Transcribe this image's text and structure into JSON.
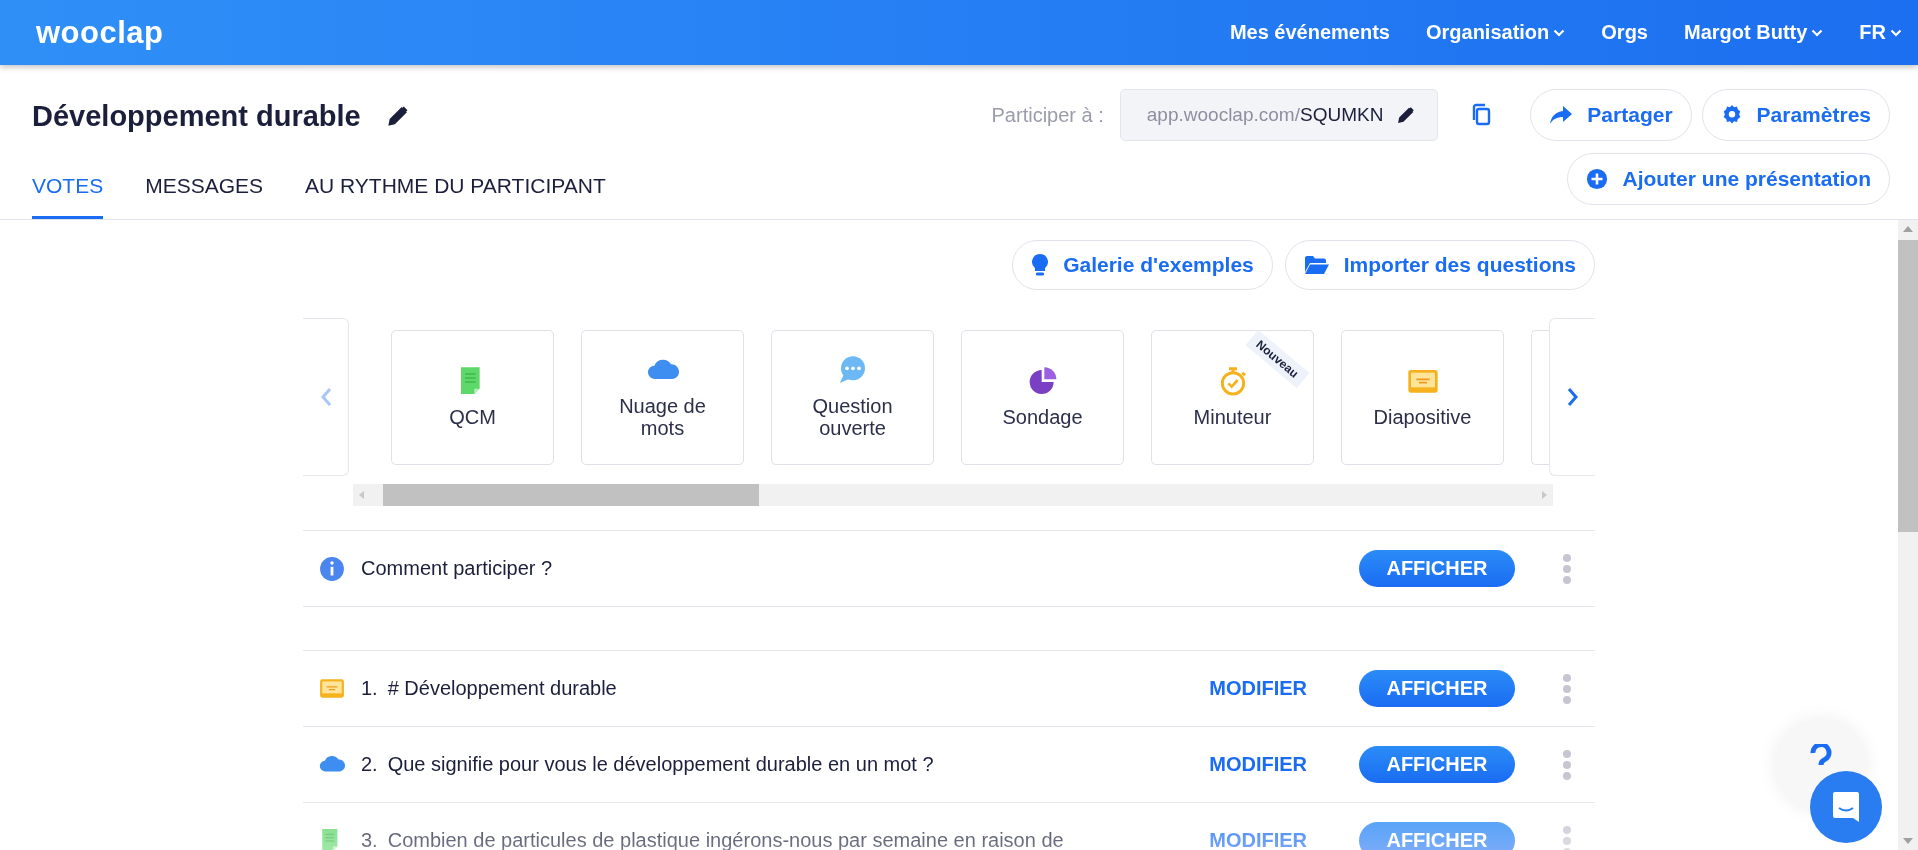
{
  "navbar": {
    "logo": "wooclap",
    "items": [
      {
        "label": "Mes événements",
        "dropdown": false
      },
      {
        "label": "Organisation",
        "dropdown": true
      },
      {
        "label": "Orgs",
        "dropdown": false
      },
      {
        "label": "Margot Butty",
        "dropdown": true
      },
      {
        "label": "FR",
        "dropdown": true
      }
    ]
  },
  "event": {
    "title": "Développement durable",
    "join_label": "Participer à :",
    "join_url_prefix": "app.wooclap.com/",
    "join_code": "SQUMKN",
    "share": "Partager",
    "settings": "Paramètres",
    "add_presentation": "Ajouter une présentation"
  },
  "tabs": [
    {
      "label": "VOTES",
      "selected": true
    },
    {
      "label": "MESSAGES",
      "selected": false
    },
    {
      "label": "AU RYTHME DU PARTICIPANT",
      "selected": false
    }
  ],
  "actions": {
    "gallery": "Galerie d'exemples",
    "import": "Importer des questions"
  },
  "question_types": [
    {
      "kind": "mcq",
      "label": "QCM"
    },
    {
      "kind": "cloud",
      "label": "Nuage de mots"
    },
    {
      "kind": "open",
      "label": "Question ouverte"
    },
    {
      "kind": "poll",
      "label": "Sondage"
    },
    {
      "kind": "timer",
      "label": "Minuteur",
      "badge": "Nouveau"
    },
    {
      "kind": "slide",
      "label": "Diapositive"
    }
  ],
  "intro": {
    "text": "Comment participer ?",
    "show": "AFFICHER"
  },
  "questions": [
    {
      "kind": "slide",
      "number": "1.",
      "text": "# Développement durable",
      "edit": "MODIFIER",
      "show": "AFFICHER"
    },
    {
      "kind": "cloud",
      "number": "2.",
      "text": "Que signifie pour vous le développement durable en un mot ?",
      "edit": "MODIFIER",
      "show": "AFFICHER"
    },
    {
      "kind": "mcq",
      "number": "3.",
      "text": "Combien de particules de plastique ingérons-nous par semaine en raison de",
      "edit": "MODIFIER",
      "show": "AFFICHER"
    }
  ]
}
